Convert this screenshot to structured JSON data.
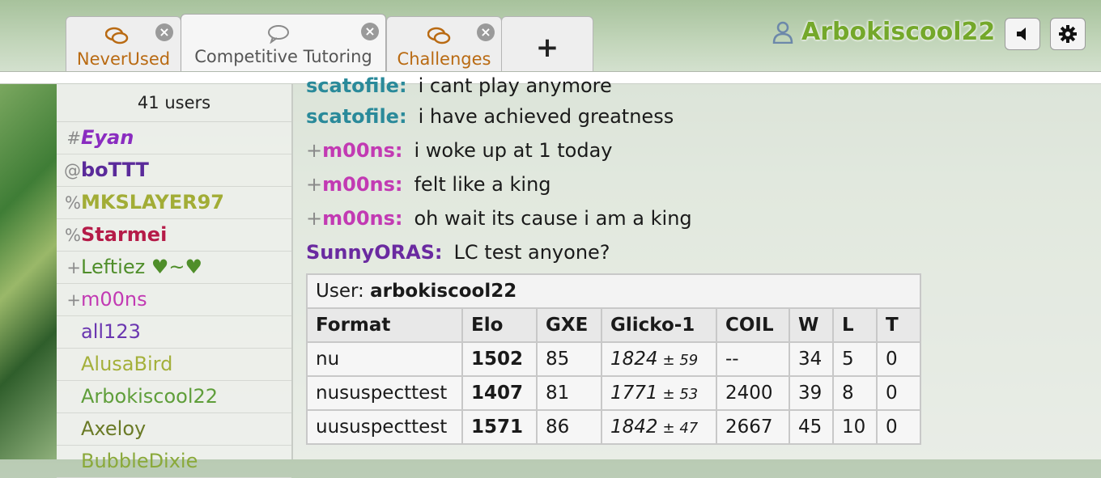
{
  "tabs": [
    {
      "label": "NeverUsed",
      "icon": "chat-bubbles-icon",
      "active": false
    },
    {
      "label": "Competitive Tutoring",
      "icon": "chat-bubble-icon",
      "active": true
    },
    {
      "label": "Challenges",
      "icon": "chat-bubbles-icon",
      "active": false
    },
    {
      "label": "+"
    }
  ],
  "header": {
    "username": "Arbokiscool22",
    "username_color": "#74a82b",
    "sound_icon": "volume-icon",
    "settings_icon": "gear-icon"
  },
  "userlist": {
    "count_label": "41 users",
    "users": [
      {
        "rank": "#",
        "name": "Eyan",
        "color": "#8a2cc0",
        "style": "bold-italic"
      },
      {
        "rank": "@",
        "name": "boTTT",
        "color": "#5a2a9a",
        "style": "bold"
      },
      {
        "rank": "%",
        "name": "MKSLAYER97",
        "color": "#a2ad36",
        "style": "bold"
      },
      {
        "rank": "%",
        "name": "Starmei",
        "color": "#b51b48",
        "style": "bold"
      },
      {
        "rank": "+",
        "name": "Leftiez ♥~♥",
        "color": "#4f8e2a",
        "style": "normal"
      },
      {
        "rank": "+",
        "name": "m00ns",
        "color": "#c23ab3",
        "style": "normal"
      },
      {
        "rank": "",
        "name": "all123",
        "color": "#6a36b0",
        "style": "normal"
      },
      {
        "rank": "",
        "name": "AlusaBird",
        "color": "#a4b03a",
        "style": "normal"
      },
      {
        "rank": "",
        "name": "Arbokiscool22",
        "color": "#5f9e3a",
        "style": "normal"
      },
      {
        "rank": "",
        "name": "Axeloy",
        "color": "#6a7a26",
        "style": "normal"
      },
      {
        "rank": "",
        "name": "BubbleDixie",
        "color": "#8aa93a",
        "style": "normal"
      }
    ]
  },
  "chat": {
    "messages": [
      {
        "group": "",
        "author": "scatofile:",
        "author_color": "#2a8a9a",
        "text": "i cant play anymore"
      },
      {
        "group": "",
        "author": "scatofile:",
        "author_color": "#2a8a9a",
        "text": "i have achieved greatness"
      },
      {
        "group": "+",
        "author": "m00ns:",
        "author_color": "#c23ab3",
        "text": "i woke up at 1 today"
      },
      {
        "group": "+",
        "author": "m00ns:",
        "author_color": "#c23ab3",
        "text": "felt like a king"
      },
      {
        "group": "+",
        "author": "m00ns:",
        "author_color": "#c23ab3",
        "text": "oh wait its cause i am a king"
      },
      {
        "group": "",
        "author": "SunnyORAS:",
        "author_color": "#6a2aa0",
        "text": "LC test anyone?"
      }
    ],
    "ranking": {
      "user_label": "User:",
      "user_name": "arbokiscool22",
      "headers": [
        "Format",
        "Elo",
        "GXE",
        "Glicko-1",
        "COIL",
        "W",
        "L",
        "T"
      ],
      "rows": [
        {
          "format": "nu",
          "elo": "1502",
          "gxe": "85",
          "glicko": "1824",
          "glicko_dev": "± 59",
          "coil": "--",
          "w": "34",
          "l": "5",
          "t": "0"
        },
        {
          "format": "nususpecttest",
          "elo": "1407",
          "gxe": "81",
          "glicko": "1771",
          "glicko_dev": "± 53",
          "coil": "2400",
          "w": "39",
          "l": "8",
          "t": "0"
        },
        {
          "format": "uususpecttest",
          "elo": "1571",
          "gxe": "86",
          "glicko": "1842",
          "glicko_dev": "± 47",
          "coil": "2667",
          "w": "45",
          "l": "10",
          "t": "0"
        }
      ]
    }
  }
}
